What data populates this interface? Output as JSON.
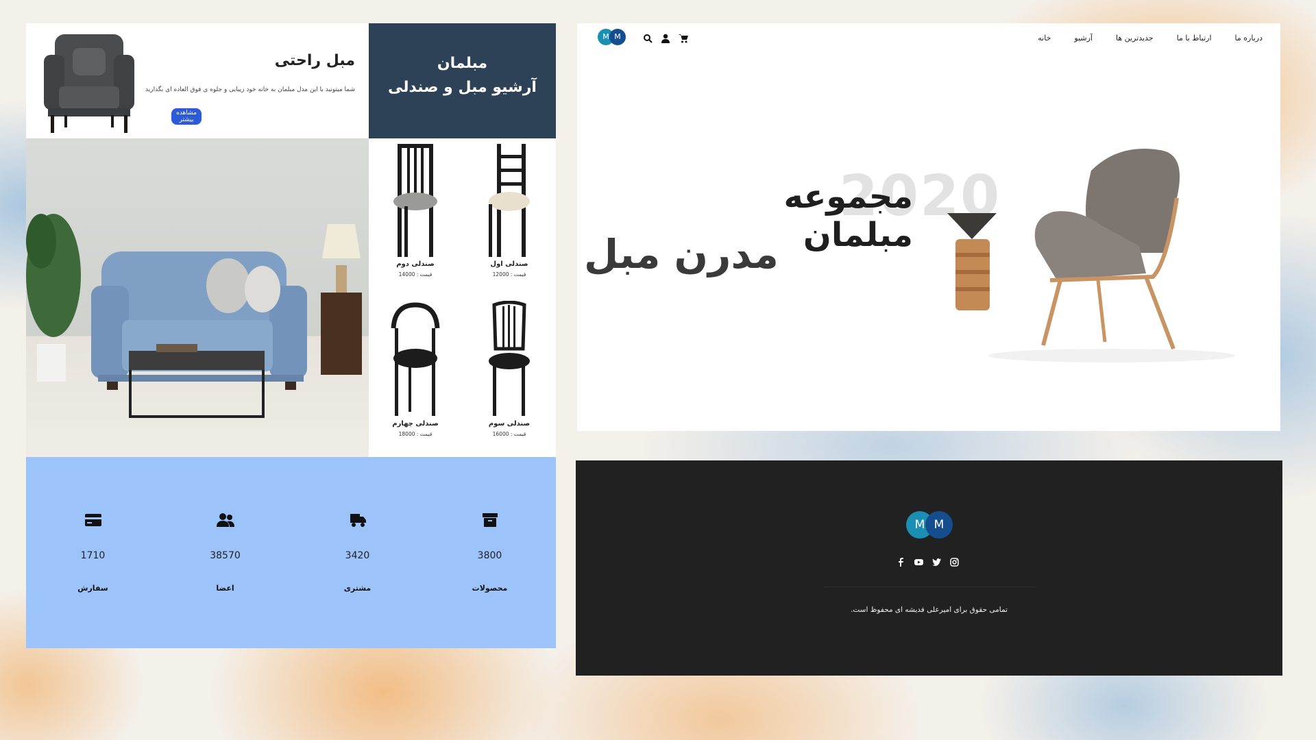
{
  "left_panel": {
    "hero": {
      "title": "مبل راحتی",
      "description": "شما میتونید با این مدل مبلمان به خانه خود زیبایی و جلوه ی فوق العاده ای بگذارید",
      "button_label": "مشاهده بیشتر"
    },
    "brand": {
      "line1": "مبلمان",
      "line2": "آرشیو مبل و صندلی"
    },
    "chairs": [
      {
        "name": "صندلی اول",
        "price": "قیمت : 12000"
      },
      {
        "name": "صندلی دوم",
        "price": "قیمت : 14000"
      },
      {
        "name": "صندلی سوم",
        "price": "قیمت : 16000"
      },
      {
        "name": "صندلی چهارم",
        "price": "قیمت : 18000"
      }
    ],
    "stats": [
      {
        "icon": "archive-icon",
        "value": "3800",
        "label": "محصولات"
      },
      {
        "icon": "truck-icon",
        "value": "3420",
        "label": "مشتری"
      },
      {
        "icon": "users-icon",
        "value": "38570",
        "label": "اعضا"
      },
      {
        "icon": "card-icon",
        "value": "1710",
        "label": "سفارش"
      }
    ]
  },
  "hero": {
    "logo": {
      "letter_a": "M",
      "letter_b": "M"
    },
    "nav": {
      "home": "خانه",
      "archive": "آرشیو",
      "newest": "جدیدترین ها",
      "contact": "ارتباط با ما",
      "about": "درباره ما"
    },
    "year": "2020",
    "headline_line1": "مجموعه مبلمان",
    "headline_line2": "مدرن مبل"
  },
  "footer": {
    "logo": {
      "letter_a": "M",
      "letter_b": "M"
    },
    "copyright": "تمامی حقوق برای امیرعلی فدیشه ای محفوظ است."
  },
  "colors": {
    "brand_navy": "#2d4157",
    "stats_bg": "#9cc3fa",
    "button_blue": "#2d5bd8",
    "footer_bg": "#212121",
    "logo_teal": "#1a8fb3",
    "logo_blue": "#154e8e"
  }
}
